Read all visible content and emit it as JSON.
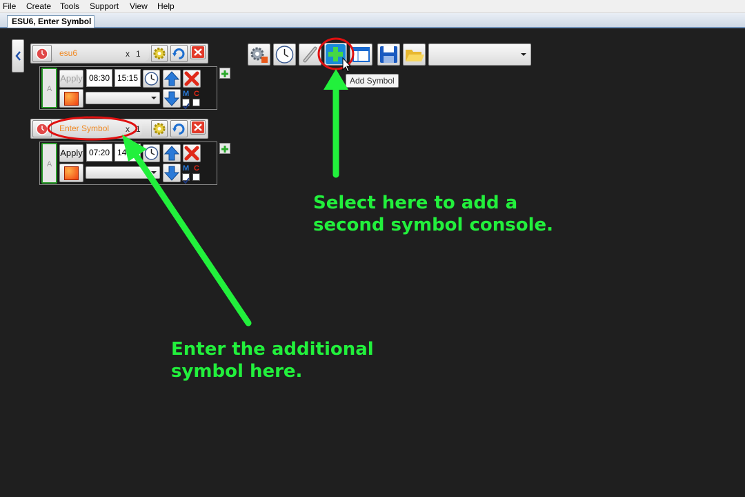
{
  "menu": [
    "File",
    "Create",
    "Tools",
    "Support",
    "View",
    "Help"
  ],
  "tab": {
    "title": "ESU6, Enter Symbol"
  },
  "consoles": [
    {
      "symbol": "esu6",
      "multiplier_x": "x",
      "multiplier_n": "1",
      "a_label": "A",
      "apply_label": "Apply",
      "start_time": "08:30",
      "end_time": "15:15",
      "m_label": "M",
      "c_label": "C"
    },
    {
      "symbol": "Enter Symbol",
      "multiplier_x": "x",
      "multiplier_n": "1",
      "a_label": "A",
      "apply_label": "Apply",
      "start_time": "07:20",
      "end_time": "14:10",
      "m_label": "M",
      "c_label": "C"
    }
  ],
  "toolbar": {
    "tooltip": "Add Symbol",
    "icons": [
      "settings-gear-icon",
      "clock-icon",
      "link-icon",
      "add-symbol-plus-icon",
      "layout-icon",
      "save-icon",
      "open-folder-icon"
    ]
  },
  "annotations": {
    "right_line1": "Select here to add a",
    "right_line2": "second symbol console.",
    "left_line1": "Enter the additional",
    "left_line2": "symbol here."
  },
  "colors": {
    "annotation": "#22f03c",
    "highlight": "#e01010",
    "symbol_text": "#f08a24",
    "background": "#1f1f1f"
  }
}
